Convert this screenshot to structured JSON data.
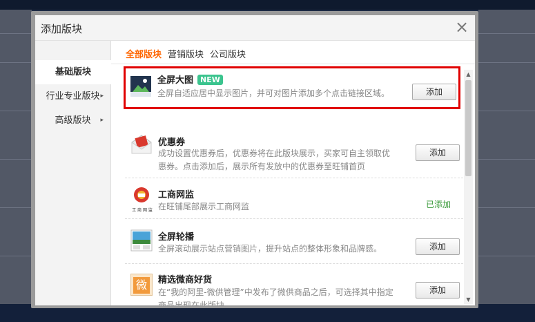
{
  "dialog": {
    "title": "添加版块",
    "close_symbol": "×"
  },
  "sidebar": {
    "items": [
      {
        "label": "基础版块",
        "active": true
      },
      {
        "label": "行业专业版块",
        "arrow": "▸"
      },
      {
        "label": "高级版块",
        "arrow": "▸"
      }
    ]
  },
  "tabs": [
    {
      "label": "全部版块",
      "active": true
    },
    {
      "label": "营销版块"
    },
    {
      "label": "公司版块"
    }
  ],
  "modules": [
    {
      "title": "全屏大图",
      "badge": "NEW",
      "desc": "全屏自适应居中显示图片，并可对图片添加多个点击链接区域。",
      "action": "添加",
      "icon": "landscape-image-icon"
    },
    {
      "title": "优惠券",
      "desc": "成功设置优惠券后，优惠券将在此版块展示，买家可自主领取优惠券。点击添加后，展示所有发放中的优惠券至旺铺首页",
      "action": "添加",
      "icon": "coupon-envelope-icon"
    },
    {
      "title": "工商网监",
      "desc": "在旺铺尾部展示工商网监",
      "status": "已添加",
      "icon": "business-supervision-badge-icon",
      "icon_caption": "工 商 网 监"
    },
    {
      "title": "全屏轮播",
      "desc": "全屏滚动展示站点营销图片，提升站点的整体形象和品牌感。",
      "action": "添加",
      "icon": "carousel-image-icon"
    },
    {
      "title": "精选微商好货",
      "desc": "在“我的阿里-微供管理”中发布了微供商品之后，可选择其中指定商品出现在此版块。",
      "action": "添加",
      "icon": "wei-shop-icon",
      "icon_char": "微"
    }
  ],
  "scrollbar": {
    "up": "▲",
    "down": "▼"
  },
  "colors": {
    "accent": "#ff6600",
    "highlight": "#e00000",
    "added": "#3a9a3a",
    "new_badge": "#3bc48e"
  }
}
